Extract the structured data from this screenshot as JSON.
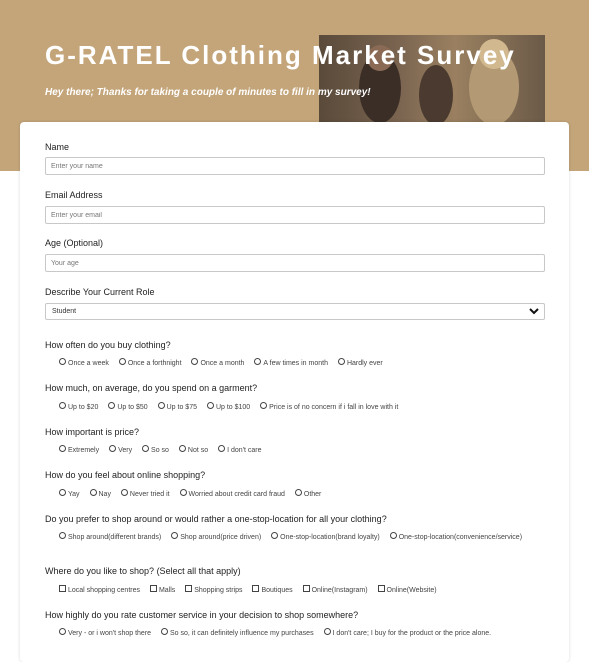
{
  "header": {
    "title": "G-RATEL Clothing Market Survey",
    "subtitle": "Hey there; Thanks for taking a couple of minutes to fill in my survey!"
  },
  "colors": {
    "banner": "#c4a57a",
    "card": "#ffffff"
  },
  "fields": {
    "name": {
      "label": "Name",
      "placeholder": "Enter your name"
    },
    "email": {
      "label": "Email Address",
      "placeholder": "Enter your email"
    },
    "age": {
      "label": "Age (Optional)",
      "placeholder": "Your age"
    },
    "role": {
      "label": "Describe Your Current Role",
      "selected": "Student",
      "icon": "chevron-down-icon"
    }
  },
  "questions": [
    {
      "text": "How often do you buy clothing?",
      "options": [
        "Once a week",
        "Once a forthnight",
        "Once a month",
        "A few times in month",
        "Hardly ever"
      ]
    },
    {
      "text": "How much, on average, do you spend on a garment?",
      "options": [
        "Up to $20",
        "Up to $50",
        "Up to $75",
        "Up to $100",
        "Price is of no concern if i fall in love with it"
      ]
    },
    {
      "text": "How important is price?",
      "options": [
        "Extremely",
        "Very",
        "So so",
        "Not so",
        "I don't care"
      ]
    },
    {
      "text": "How do you feel about online shopping?",
      "options": [
        "Yay",
        "Nay",
        "Never tried it",
        "Worried about credit card fraud",
        "Other"
      ]
    },
    {
      "text": "Do you prefer to shop around or would rather a one-stop-location for all your clothing?",
      "options": [
        "Shop around(different brands)",
        "Shop around(price driven)",
        "One-stop-location(brand loyalty)",
        "One-stop-location(convenience/service)"
      ]
    },
    {
      "text": "Where do you like to shop? (Select all that apply)",
      "options": [
        "Local shopping centres",
        "Malls",
        "Shopping strips",
        "Boutiques",
        "Online(Instagram)",
        "Online(Website)"
      ]
    },
    {
      "text": "How highly do you rate customer service in your decision to shop somewhere?",
      "options": [
        "Very - or i won't shop there",
        "So so, it can definitely influence my purchases",
        "I don't care; I buy for the product or the price alone."
      ]
    }
  ]
}
